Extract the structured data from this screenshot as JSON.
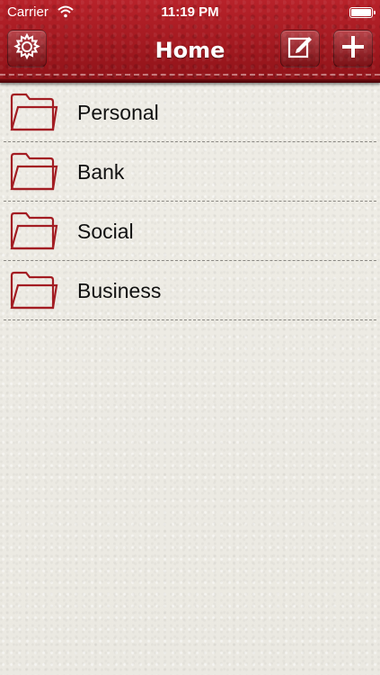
{
  "status": {
    "carrier": "Carrier",
    "time": "11:19 PM",
    "wifi_icon": "wifi-icon",
    "battery_icon": "battery-icon"
  },
  "header": {
    "title": "Home",
    "settings_icon": "gear-icon",
    "edit_icon": "compose-icon",
    "add_icon": "plus-icon"
  },
  "folders": [
    {
      "label": "Personal",
      "icon": "folder-icon"
    },
    {
      "label": "Bank",
      "icon": "folder-icon"
    },
    {
      "label": "Social",
      "icon": "folder-icon"
    },
    {
      "label": "Business",
      "icon": "folder-icon"
    }
  ],
  "colors": {
    "header_red": "#a71b22",
    "folder_red": "#a31d23",
    "background": "#eeece5"
  }
}
